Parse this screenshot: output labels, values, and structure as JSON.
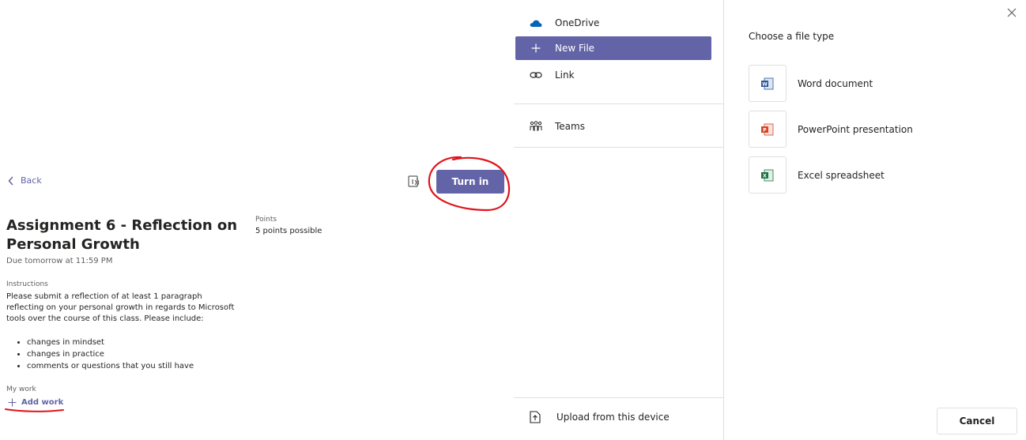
{
  "assignment": {
    "back_label": "Back",
    "turn_in_label": "Turn in",
    "title": "Assignment 6 - Reflection on Personal Growth",
    "due": "Due tomorrow at 11:59 PM",
    "points_label": "Points",
    "points_value": "5 points possible",
    "instructions_label": "Instructions",
    "instructions_text": "Please submit a reflection of at least 1 paragraph reflecting on your personal growth in regards to Microsoft tools over the course of this class. Please include:",
    "bullets": [
      "changes in mindset",
      "changes in practice",
      "comments or questions that you still have"
    ],
    "my_work_label": "My work",
    "add_work_label": "Add work"
  },
  "sources": {
    "items": [
      {
        "label": "OneDrive",
        "icon": "onedrive-icon"
      },
      {
        "label": "New File",
        "icon": "plus-icon",
        "selected": true
      },
      {
        "label": "Link",
        "icon": "link-icon"
      },
      {
        "label": "Teams",
        "icon": "teams-icon"
      }
    ],
    "upload_label": "Upload from this device"
  },
  "file_types": {
    "heading": "Choose a file type",
    "items": [
      {
        "label": "Word document",
        "icon": "word-icon",
        "color": "#2b579a"
      },
      {
        "label": "PowerPoint presentation",
        "icon": "powerpoint-icon",
        "color": "#d24726"
      },
      {
        "label": "Excel spreadsheet",
        "icon": "excel-icon",
        "color": "#217346"
      }
    ],
    "cancel_label": "Cancel"
  },
  "colors": {
    "accent": "#6264a7",
    "annotation": "#e0141b"
  }
}
